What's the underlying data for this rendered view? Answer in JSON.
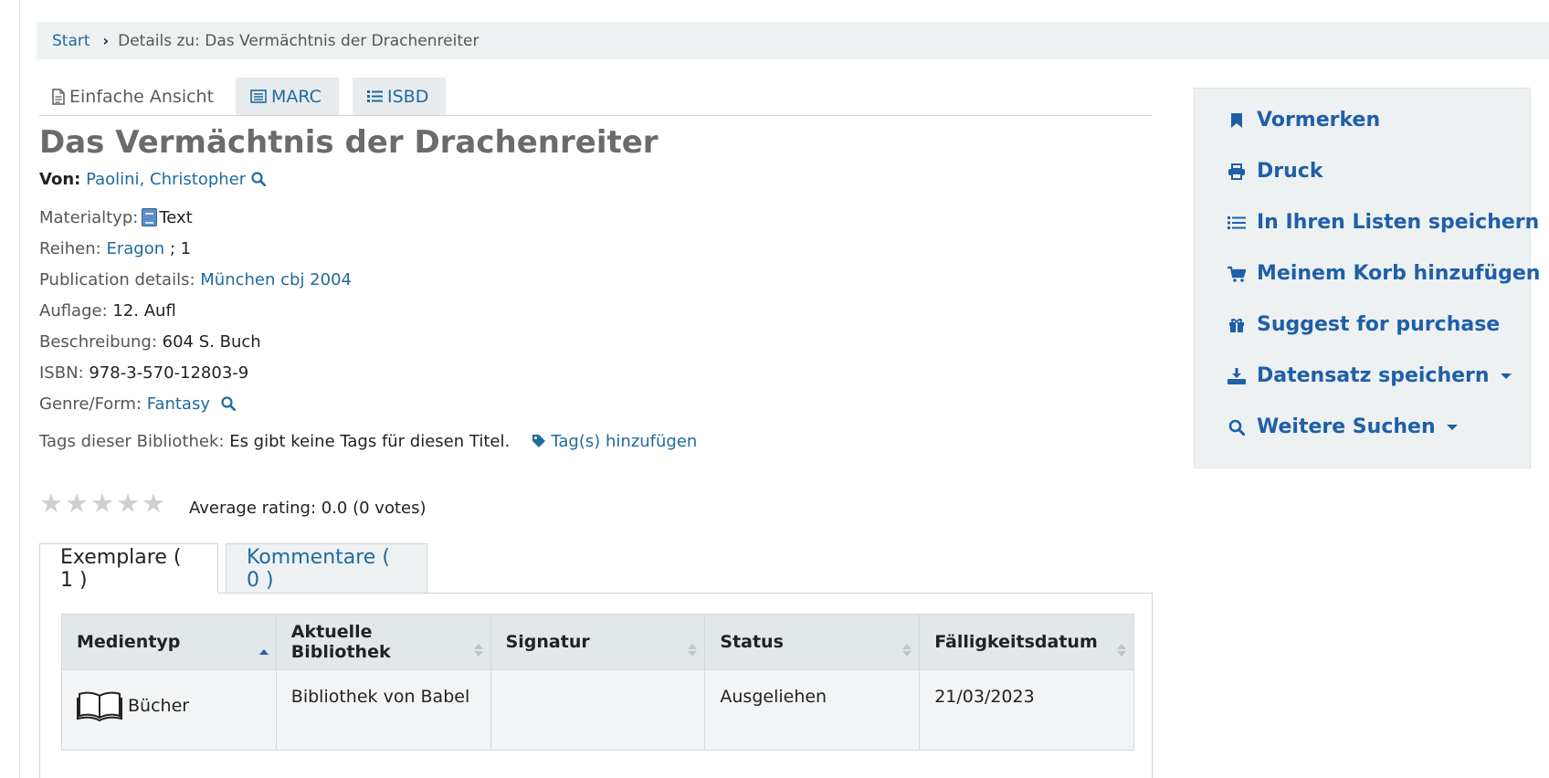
{
  "breadcrumb": {
    "home": "Start",
    "current": "Details zu: Das Vermächtnis der Drachenreiter"
  },
  "view_tabs": {
    "simple": "Einfache Ansicht",
    "marc": "MARC",
    "isbd": "ISBD"
  },
  "record": {
    "title": "Das Vermächtnis der Drachenreiter",
    "author_label": "Von:",
    "author": "Paolini, Christopher",
    "material_label": "Materialtyp:",
    "material": "Text",
    "series_label": "Reihen:",
    "series": "Eragon",
    "series_number": "; 1",
    "publication_label": "Publication details:",
    "publication": "München cbj 2004",
    "edition_label": "Auflage:",
    "edition": "12. Aufl",
    "description_label": "Beschreibung:",
    "description": "604 S. Buch",
    "isbn_label": "ISBN:",
    "isbn": "978-3-570-12803-9",
    "genre_label": "Genre/Form:",
    "genre": "Fantasy",
    "tags_label": "Tags dieser Bibliothek:",
    "tags_value": "Es gibt keine Tags für diesen Titel.",
    "add_tags": "Tag(s) hinzufügen"
  },
  "rating": {
    "stars_filled": 0,
    "stars_total": 5,
    "text": "Average rating: 0.0 (0 votes)"
  },
  "tabs": {
    "holdings": "Exemplare ( 1 )",
    "comments": "Kommentare ( 0 )"
  },
  "holdings_table": {
    "headers": [
      "Medientyp",
      "Aktuelle Bibliothek",
      "Signatur",
      "Status",
      "Fälligkeitsdatum"
    ],
    "rows": [
      {
        "media_type": "Bücher",
        "library": "Bibliothek von Babel",
        "call_number": "",
        "status": "Ausgeliehen",
        "due_date": "21/03/2023"
      }
    ]
  },
  "actions": {
    "hold": "Vormerken",
    "print": "Druck",
    "save_lists": "In Ihren Listen speichern",
    "add_cart": "Meinem Korb hinzufügen",
    "suggest": "Suggest for purchase",
    "save_record": "Datensatz speichern",
    "more_searches": "Weitere Suchen"
  },
  "colors": {
    "link": "#1f6a9e",
    "action": "#1f5fa8",
    "panel_bg": "#eef1f2"
  }
}
